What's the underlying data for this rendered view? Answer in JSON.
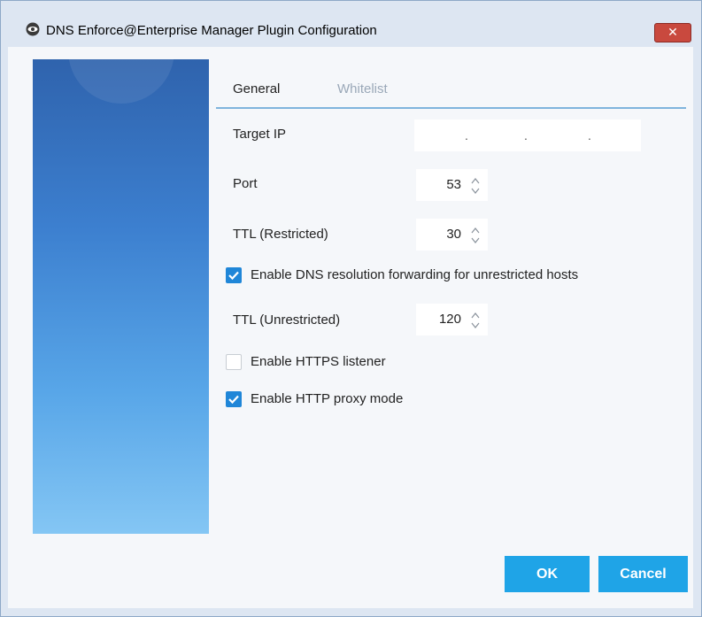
{
  "window": {
    "title": "DNS Enforce@Enterprise Manager Plugin Configuration",
    "close_label": "✕"
  },
  "tabs": [
    {
      "label": "General",
      "active": true
    },
    {
      "label": "Whitelist",
      "active": false
    }
  ],
  "form": {
    "target_ip": {
      "label": "Target IP",
      "value": ".     .     ."
    },
    "port": {
      "label": "Port",
      "value": "53"
    },
    "ttl_restricted": {
      "label": "TTL (Restricted)",
      "value": "30"
    },
    "dns_forwarding": {
      "label": "Enable DNS resolution forwarding for unrestricted hosts",
      "checked": true
    },
    "ttl_unrestricted": {
      "label": "TTL (Unrestricted)",
      "value": "120"
    },
    "https_listener": {
      "label": "Enable HTTPS listener",
      "checked": false
    },
    "http_proxy": {
      "label": "Enable HTTP proxy mode",
      "checked": true
    }
  },
  "buttons": {
    "ok": "OK",
    "cancel": "Cancel"
  },
  "colors": {
    "accent": "#1fa4e7",
    "checkbox": "#1f86d8",
    "close": "#c9493e"
  },
  "icons": {
    "title": "eye-icon",
    "close": "close-icon",
    "spinner": "spinner-arrows-icon",
    "check": "checkmark-icon"
  }
}
